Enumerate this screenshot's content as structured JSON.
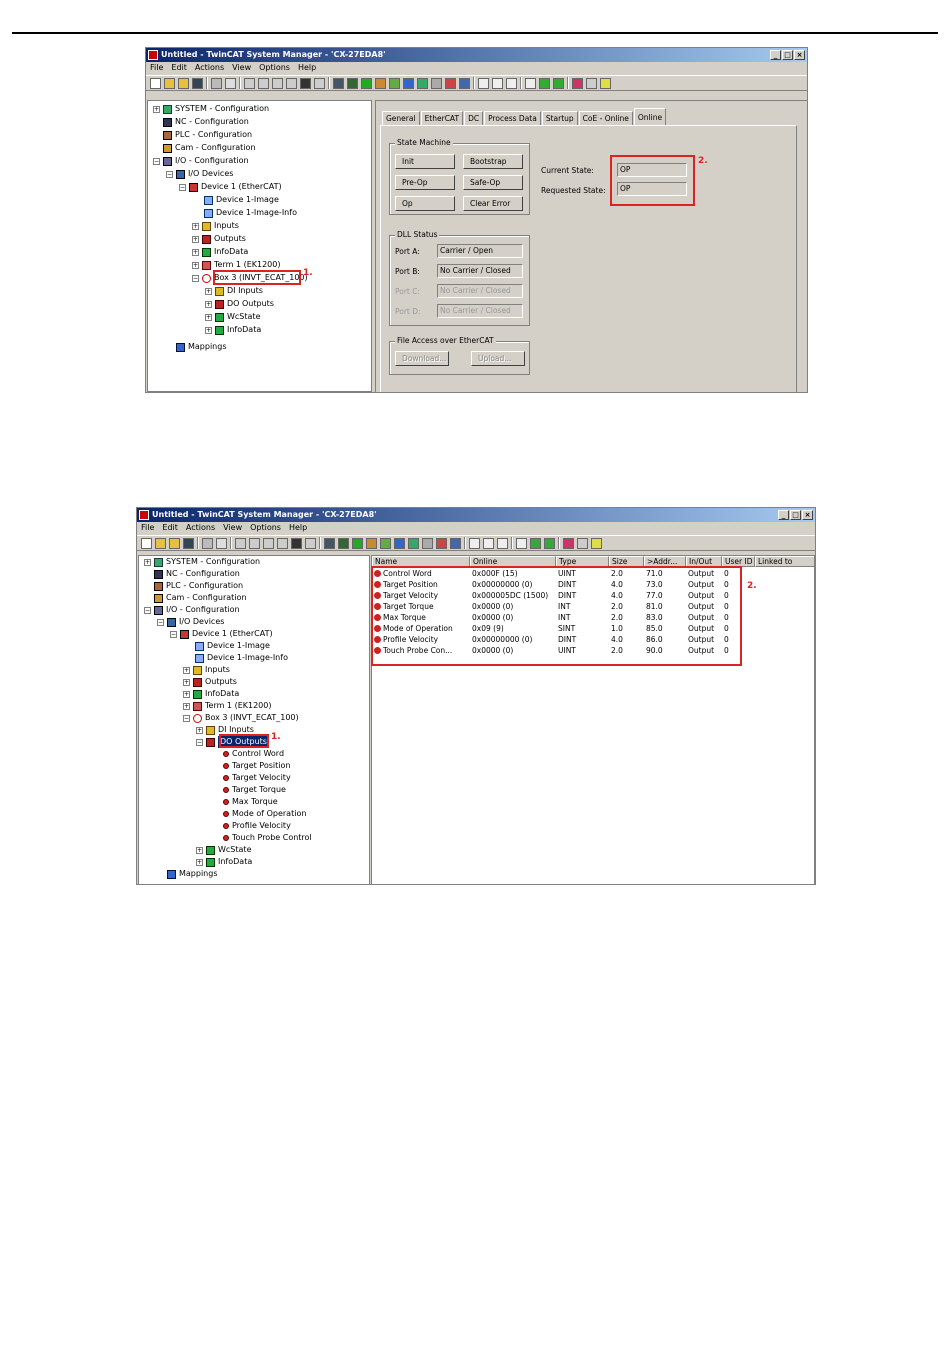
{
  "window_title": "Untitled - TwinCAT System Manager - 'CX-27EDA8'",
  "window_buttons": [
    "_",
    "□",
    "×"
  ],
  "menu": [
    "File",
    "Edit",
    "Actions",
    "View",
    "Options",
    "Help"
  ],
  "tree1": {
    "system": "SYSTEM - Configuration",
    "nc": "NC - Configuration",
    "plc": "PLC - Configuration",
    "cam": "Cam - Configuration",
    "io": "I/O - Configuration",
    "io_devices": "I/O Devices",
    "device1": "Device 1 (EtherCAT)",
    "device1_image": "Device 1-Image",
    "device1_image_info": "Device 1-Image-Info",
    "inputs": "Inputs",
    "outputs": "Outputs",
    "infodata": "InfoData",
    "term1": "Term 1 (EK1200)",
    "box3": "Box 3 (INVT_ECAT_100)",
    "di_inputs": "DI Inputs",
    "do_outputs": "DO Outputs",
    "wcstate": "WcState",
    "box_infodata": "InfoData",
    "mappings": "Mappings"
  },
  "tabs": [
    "General",
    "EtherCAT",
    "DC",
    "Process Data",
    "Startup",
    "CoE - Online",
    "Online"
  ],
  "state_machine": {
    "title": "State Machine",
    "init": "Init",
    "bootstrap": "Bootstrap",
    "preop": "Pre-Op",
    "safeop": "Safe-Op",
    "op": "Op",
    "clear_error": "Clear Error",
    "current_state_label": "Current State:",
    "current_state": "OP",
    "requested_state_label": "Requested State:",
    "requested_state": "OP"
  },
  "dll_status": {
    "title": "DLL Status",
    "port_a_label": "Port A:",
    "port_a": "Carrier / Open",
    "port_b_label": "Port B:",
    "port_b": "No Carrier / Closed",
    "port_c_label": "Port C:",
    "port_c": "No Carrier / Closed",
    "port_d_label": "Port D:",
    "port_d": "No Carrier / Closed"
  },
  "file_access": {
    "title": "File Access over EtherCAT",
    "download": "Download...",
    "upload": "Upload..."
  },
  "annot": {
    "one": "1.",
    "two": "2."
  },
  "tree2": {
    "system": "SYSTEM - Configuration",
    "nc": "NC - Configuration",
    "plc": "PLC - Configuration",
    "cam": "Cam - Configuration",
    "io": "I/O - Configuration",
    "io_devices": "I/O Devices",
    "device1": "Device 1 (EtherCAT)",
    "device1_image": "Device 1-Image",
    "device1_image_info": "Device 1-Image-Info",
    "inputs": "Inputs",
    "outputs": "Outputs",
    "infodata": "InfoData",
    "term1": "Term 1 (EK1200)",
    "box3": "Box 3 (INVT_ECAT_100)",
    "di_inputs": "DI Inputs",
    "do_outputs": "DO Outputs",
    "vars": [
      "Control Word",
      "Target Position",
      "Target Velocity",
      "Target Torque",
      "Max Torque",
      "Mode of Operation",
      "Profile Velocity",
      "Touch Probe Control"
    ],
    "wcstate": "WcState",
    "box_infodata": "InfoData",
    "mappings": "Mappings"
  },
  "table": {
    "columns": [
      "Name",
      "Online",
      "Type",
      "Size",
      ">Addr...",
      "In/Out",
      "User ID",
      "Linked to"
    ],
    "rows": [
      [
        "Control Word",
        "0x000F (15)",
        "UINT",
        "2.0",
        "71.0",
        "Output",
        "0"
      ],
      [
        "Target Position",
        "0x00000000 (0)",
        "DINT",
        "4.0",
        "73.0",
        "Output",
        "0"
      ],
      [
        "Target Velocity",
        "0x000005DC (1500)",
        "DINT",
        "4.0",
        "77.0",
        "Output",
        "0"
      ],
      [
        "Target Torque",
        "0x0000 (0)",
        "INT",
        "2.0",
        "81.0",
        "Output",
        "0"
      ],
      [
        "Max Torque",
        "0x0000 (0)",
        "INT",
        "2.0",
        "83.0",
        "Output",
        "0"
      ],
      [
        "Mode of Operation",
        "0x09 (9)",
        "SINT",
        "1.0",
        "85.0",
        "Output",
        "0"
      ],
      [
        "Profile Velocity",
        "0x00000000 (0)",
        "DINT",
        "4.0",
        "86.0",
        "Output",
        "0"
      ],
      [
        "Touch Probe Con...",
        "0x0000 (0)",
        "UINT",
        "2.0",
        "90.0",
        "Output",
        "0"
      ]
    ]
  }
}
